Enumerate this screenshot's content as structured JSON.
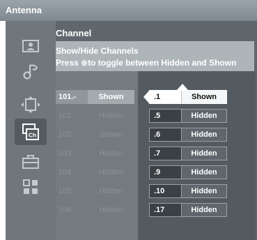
{
  "window": {
    "title": "Antenna"
  },
  "sidebar": {
    "items": [
      {
        "icon": "picture-icon",
        "active": false
      },
      {
        "icon": "sound-icon",
        "active": false
      },
      {
        "icon": "screen-format-icon",
        "active": false
      },
      {
        "icon": "channel-list-icon",
        "active": true,
        "badge": "Ch"
      },
      {
        "icon": "toolbox-icon",
        "active": false
      },
      {
        "icon": "grid-icon",
        "active": false
      }
    ]
  },
  "main": {
    "title": "Channel",
    "info_title": "Show/Hide Channels",
    "info_text_before": "Press ",
    "info_text_icon": "⊕",
    "info_text_after": "to toggle between Hidden and Shown"
  },
  "channels": [
    {
      "number": "101.-",
      "status": "Shown"
    },
    {
      "number": "102",
      "status": "Hidden"
    },
    {
      "number": "102.-",
      "status": "Shown"
    },
    {
      "number": "103",
      "status": "Hidden"
    },
    {
      "number": "104",
      "status": "Hidden"
    },
    {
      "number": "105",
      "status": "Hidden"
    },
    {
      "number": "106",
      "status": "Hidden"
    }
  ],
  "subchannels": [
    {
      "number": ".1",
      "status": "Shown"
    },
    {
      "number": ".5",
      "status": "Hidden"
    },
    {
      "number": ".6",
      "status": "Hidden"
    },
    {
      "number": ".7",
      "status": "Hidden"
    },
    {
      "number": ".9",
      "status": "Hidden"
    },
    {
      "number": ".10",
      "status": "Hidden"
    },
    {
      "number": ".17",
      "status": "Hidden"
    }
  ]
}
